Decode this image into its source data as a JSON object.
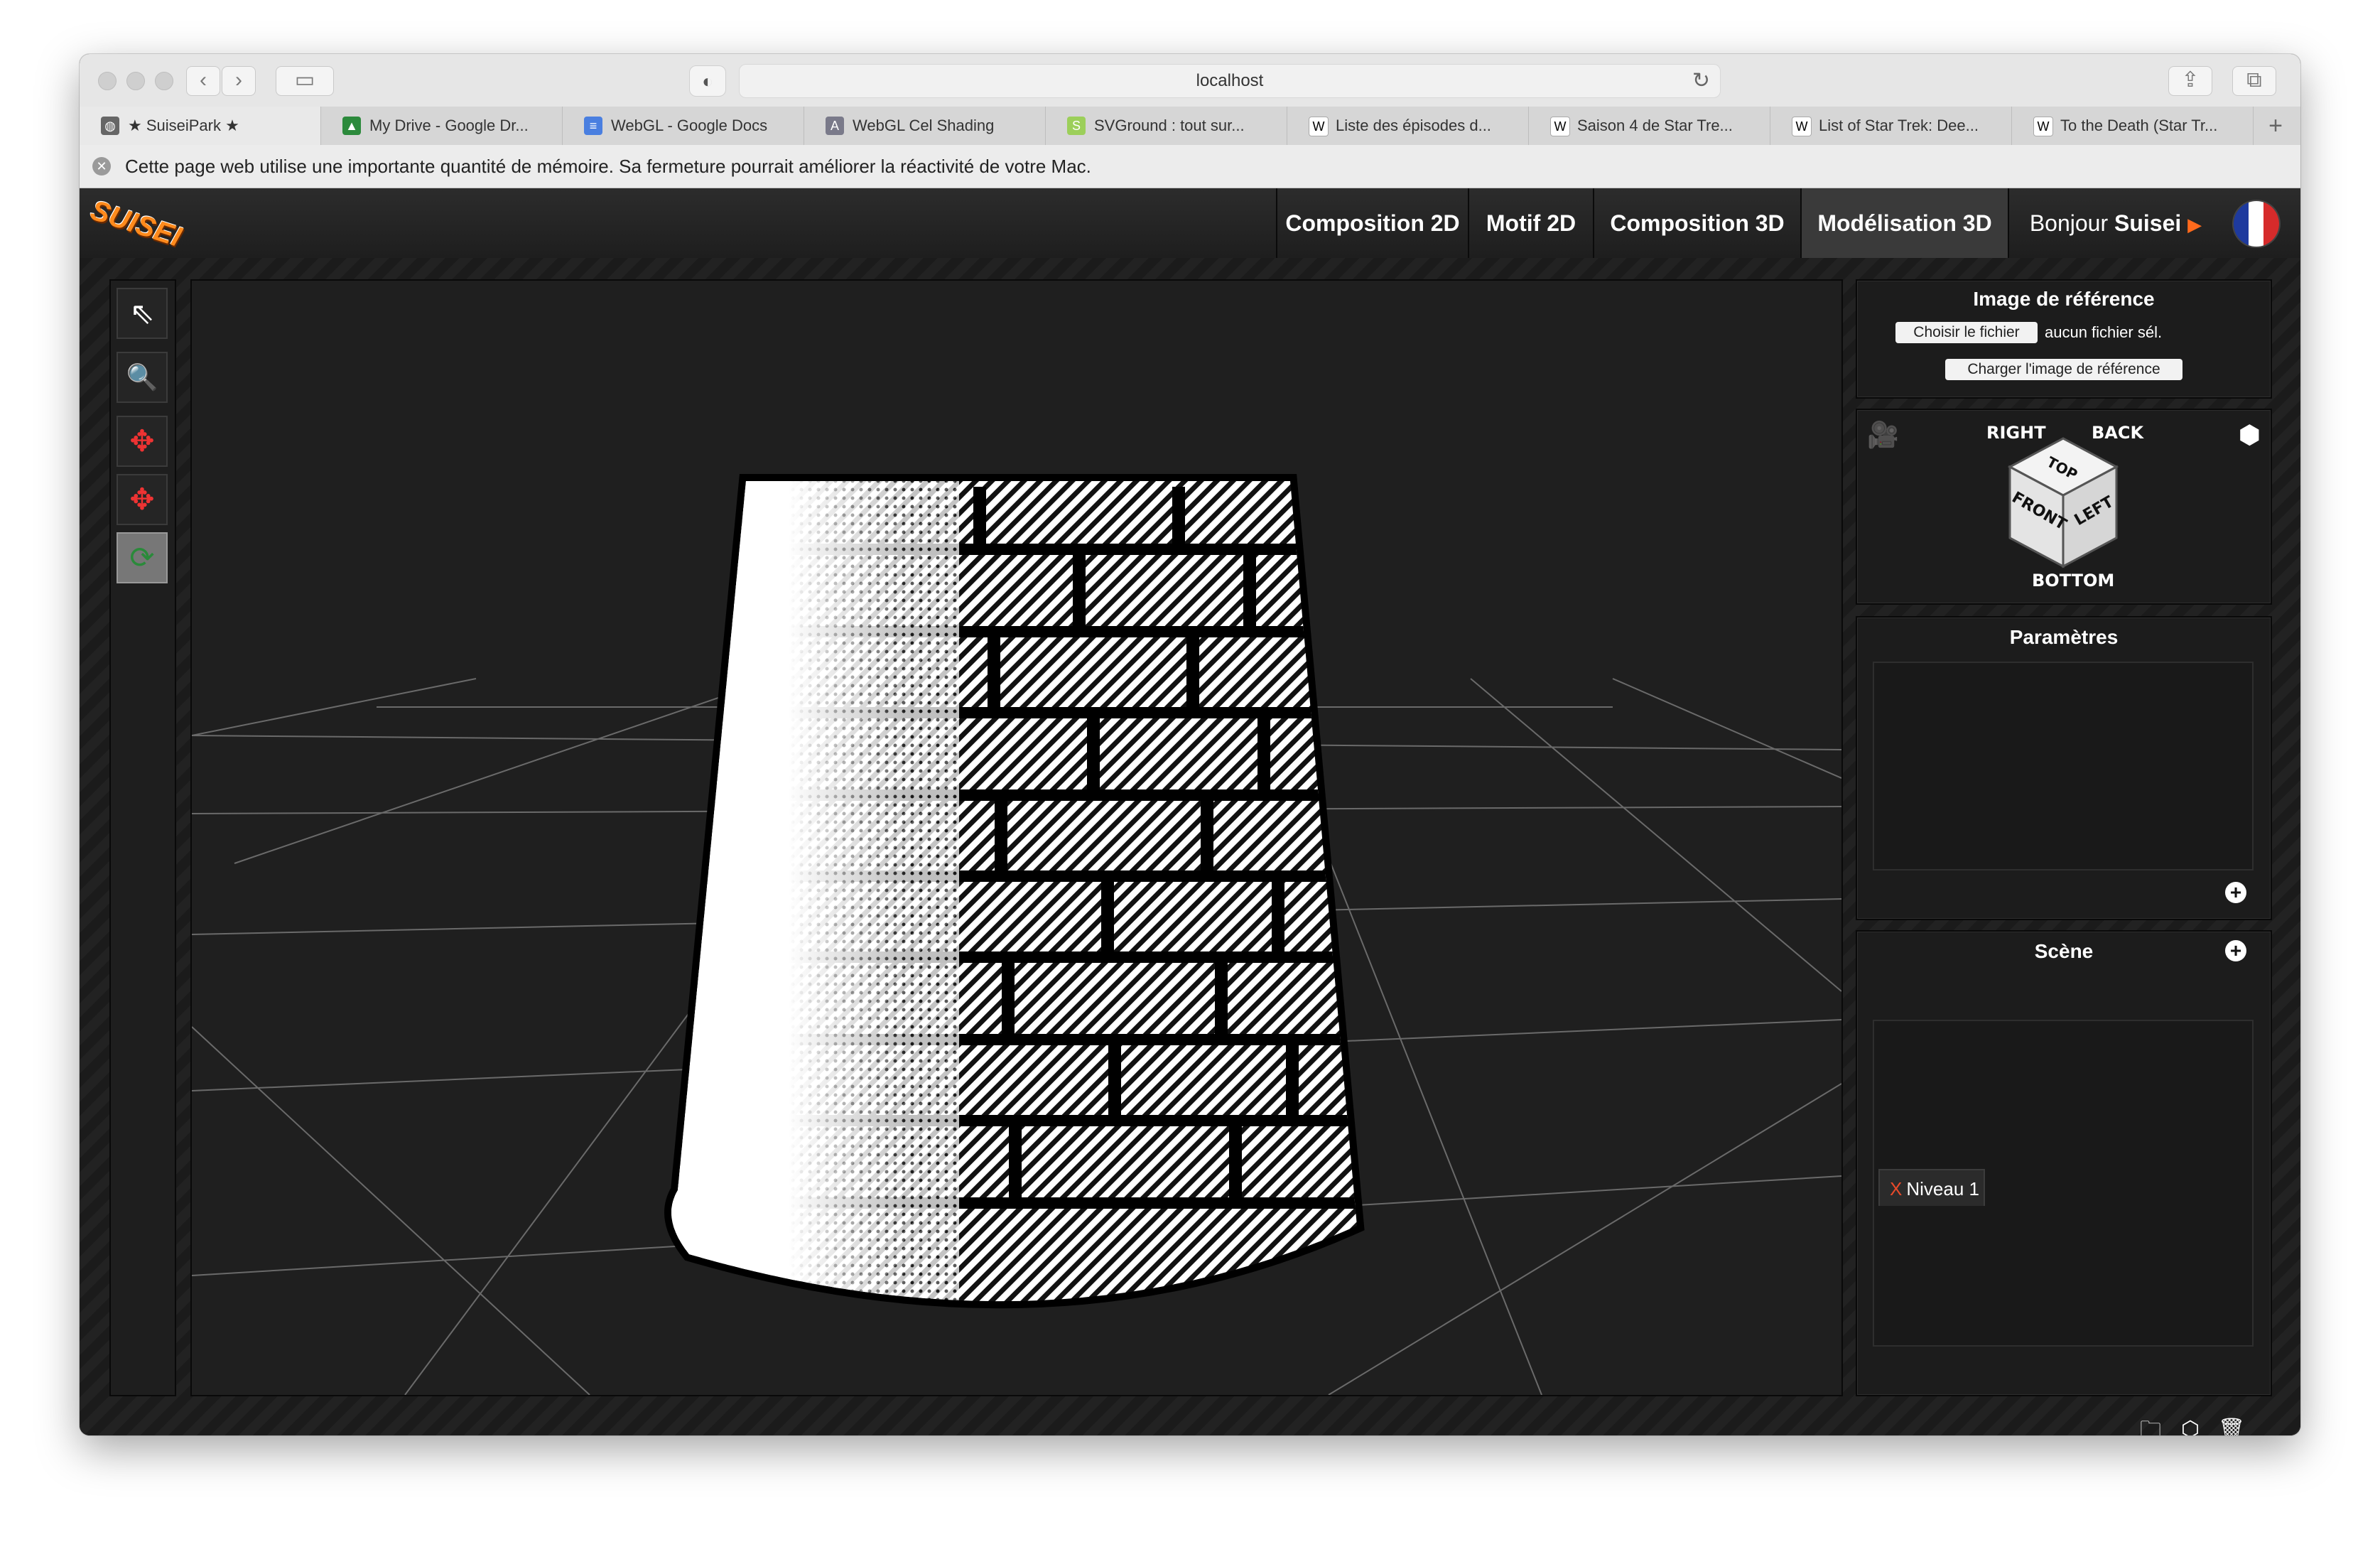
{
  "browser": {
    "url": "localhost",
    "tabs": [
      {
        "label": "★ SuiseiPark ★",
        "icon": "globe-icon",
        "active": true
      },
      {
        "label": "My Drive - Google Dr...",
        "icon": "drive-icon"
      },
      {
        "label": "WebGL - Google Docs",
        "icon": "docs-icon"
      },
      {
        "label": "WebGL Cel Shading",
        "icon": "font-icon"
      },
      {
        "label": "SVGround : tout sur...",
        "icon": "svg-icon"
      },
      {
        "label": "Liste des épisodes d...",
        "icon": "wikipedia-icon"
      },
      {
        "label": "Saison 4 de Star Tre...",
        "icon": "wikipedia-icon"
      },
      {
        "label": "List of Star Trek: Dee...",
        "icon": "wikipedia-icon"
      },
      {
        "label": "To the Death (Star Tr...",
        "icon": "wikipedia-icon"
      }
    ],
    "memory_warning": "Cette page web utilise une importante quantité de mémoire. Sa fermeture pourrait améliorer la réactivité de votre Mac."
  },
  "app": {
    "logo": "SUISEI",
    "nav": [
      {
        "label": "Composition 2D"
      },
      {
        "label": "Motif 2D"
      },
      {
        "label": "Composition 3D"
      },
      {
        "label": "Modélisation 3D",
        "selected": true
      }
    ],
    "greeting_prefix": "Bonjour",
    "greeting_name": "Suisei",
    "greeting_arrow": "▶",
    "language_flag": "france-flag-icon",
    "tools": [
      {
        "name": "select-arrow-icon",
        "glyph": "⇖"
      },
      {
        "name": "magnifier-icon",
        "glyph": "🔍"
      },
      {
        "name": "move-icon",
        "glyph": "✥"
      },
      {
        "name": "scale-icon",
        "glyph": "✥"
      },
      {
        "name": "rotate-icon",
        "glyph": "⟳",
        "selected": true
      }
    ],
    "reference_image": {
      "title": "Image de référence",
      "choose_file": "Choisir le fichier",
      "no_file": "aucun fichier sél.",
      "load_button": "Charger l'image de référence"
    },
    "view_cube": {
      "right": "RIGHT",
      "back": "BACK",
      "top": "TOP",
      "front": "FRONT",
      "left": "LEFT",
      "bottom": "BOTTOM"
    },
    "parameters": {
      "title": "Paramètres"
    },
    "scene": {
      "title": "Scène",
      "tab_remove": "X",
      "tab_label": "Niveau 1"
    },
    "colors": {
      "accent": "#ff6a1c",
      "panel_bg": "#1c1c1c",
      "viewport_bg": "#1f1f1f"
    }
  }
}
